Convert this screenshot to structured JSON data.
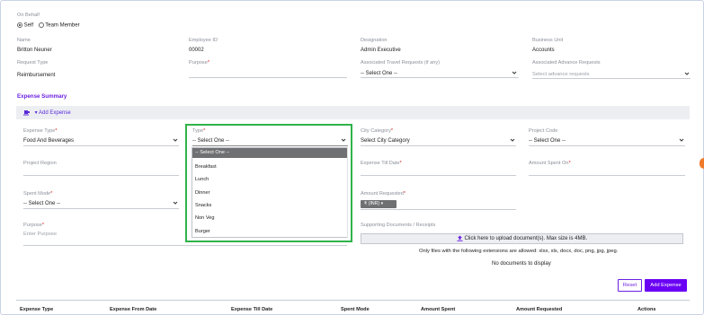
{
  "on_behalf": {
    "label": "On Behalf",
    "options": [
      "Self",
      "Team Member"
    ],
    "selected": "Self"
  },
  "header_fields": {
    "name": {
      "label": "Name",
      "value": "Britton Neuner"
    },
    "employee_id": {
      "label": "Employee ID",
      "value": "00002"
    },
    "designation": {
      "label": "Designation",
      "value": "Admin Executive"
    },
    "business_unit": {
      "label": "Business Unit",
      "value": "Accounts"
    },
    "request_type": {
      "label": "Request Type",
      "value": "Reimbursement"
    },
    "purpose": {
      "label": "Purpose",
      "value": ""
    },
    "assoc_travel": {
      "label": "Associated Travel Requests (if any)",
      "value": "-- Select One --"
    },
    "assoc_advance": {
      "label": "Associated Advance Requests",
      "placeholder": "Select advance requests"
    }
  },
  "expense_summary": {
    "title": "Expense Summary",
    "add_expense_label": "Add Expense"
  },
  "form": {
    "expense_type": {
      "label": "Expense Type",
      "value": "Food And Beverages"
    },
    "type": {
      "label": "Type",
      "value": "-- Select One --"
    },
    "city_category": {
      "label": "City Category",
      "value": "Select City Category"
    },
    "project_code": {
      "label": "Project Code",
      "value": "-- Select One --"
    },
    "project_region": {
      "label": "Project Region"
    },
    "expense_till_date": {
      "label": "Expense Till Date"
    },
    "amount_spent_on": {
      "label": "Amount Spent On"
    },
    "spent_mode": {
      "label": "Spent Mode",
      "value": "-- Select One --"
    },
    "amount_requested": {
      "label": "Amount Requested",
      "currency": "₹ (INR)"
    },
    "purpose": {
      "label": "Purpose",
      "placeholder": "Enter Purpose"
    },
    "supporting_docs": {
      "label": "Supporting Documents / Receipts",
      "upload_label": "Click here to upload document(s). Max size is 4MB.",
      "extensions_note": "Only files with the following extensions are allowed: xlsx, xls, docx, doc, png, jpg, jpeg.",
      "no_docs": "No documents to display"
    }
  },
  "type_dropdown": {
    "options": [
      "-- Select One --",
      "Breakfast",
      "Lunch",
      "Dinner",
      "Snacks",
      "Non Veg",
      "Burger"
    ],
    "highlighted": "-- Select One --"
  },
  "buttons": {
    "reset": "Reset",
    "add_expense": "Add Expense"
  },
  "table": {
    "columns": [
      "Expense Type",
      "Expense From Date",
      "Expense Till Date",
      "Spent Mode",
      "Amount Spent",
      "Amount Requested",
      "Actions"
    ]
  },
  "colors": {
    "accent": "#6a00f4",
    "highlight_box": "#2fb34a",
    "required": "#d9241c"
  }
}
